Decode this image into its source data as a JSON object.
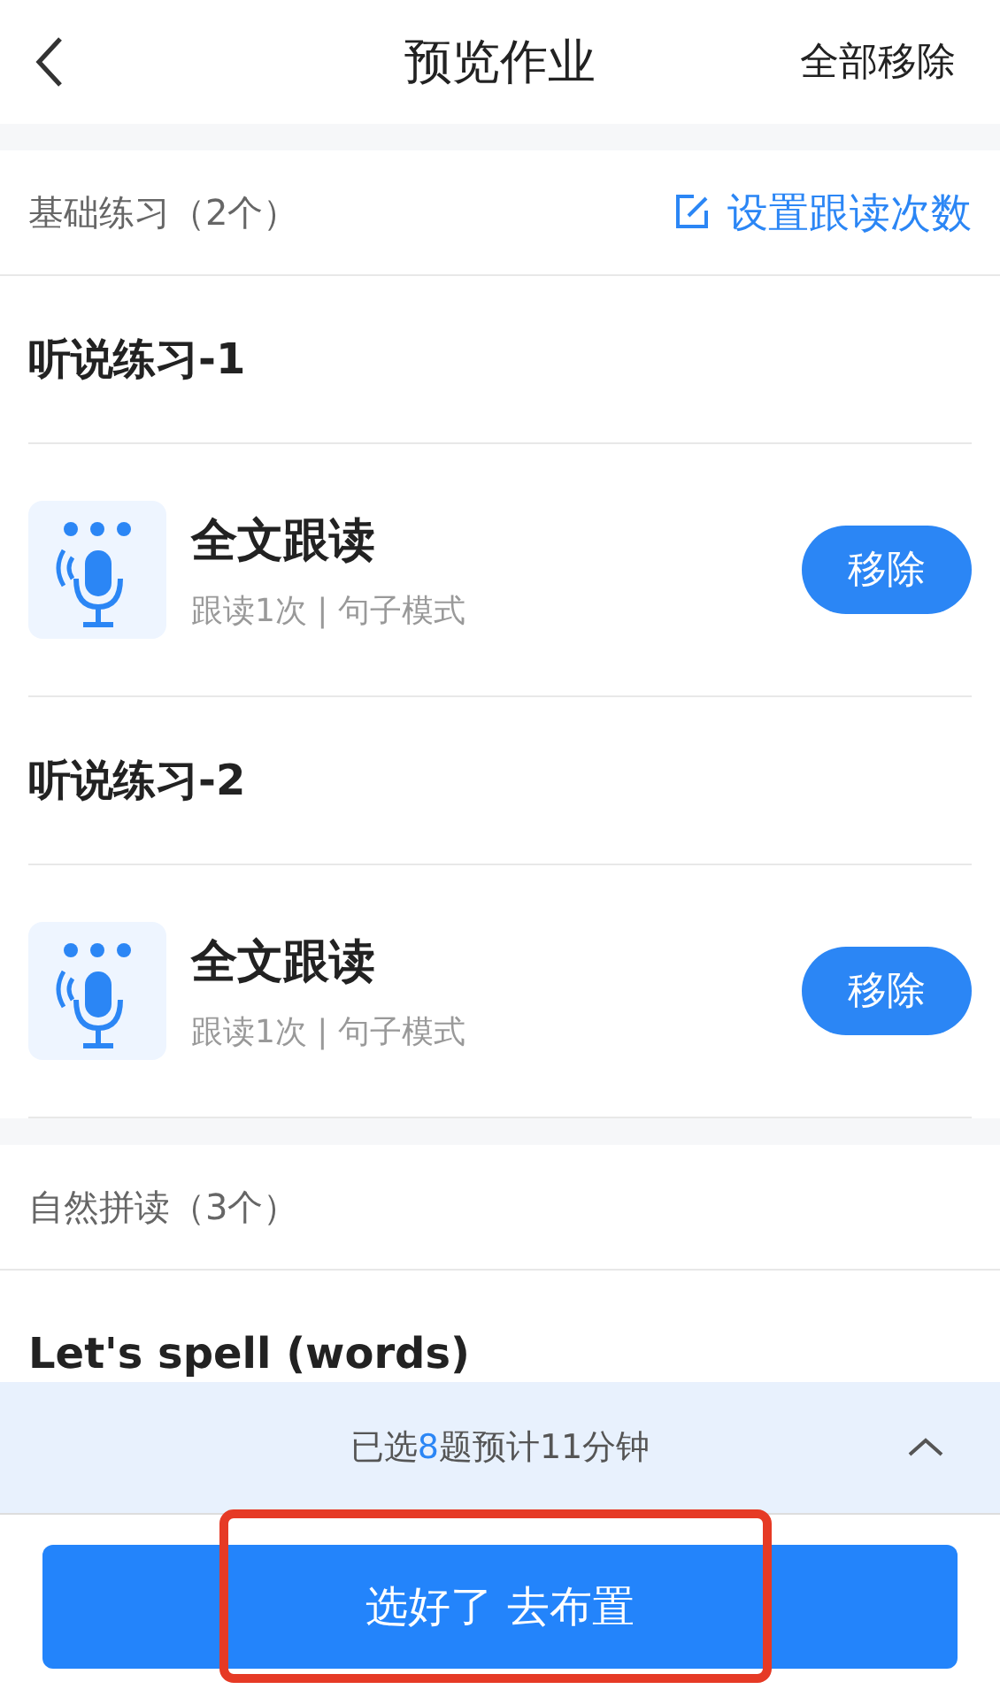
{
  "header": {
    "title": "预览作业",
    "action": "全部移除"
  },
  "sections": [
    {
      "title": "基础练习（2个）",
      "action": "设置跟读次数",
      "groups": [
        {
          "title": "听说练习-1",
          "items": [
            {
              "kind": "reading",
              "name": "全文跟读",
              "meta": "跟读1次 | 句子模式",
              "button": "移除"
            }
          ]
        },
        {
          "title": "听说练习-2",
          "items": [
            {
              "kind": "reading",
              "name": "全文跟读",
              "meta": "跟读1次 | 句子模式",
              "button": "移除"
            }
          ]
        }
      ]
    },
    {
      "title": "自然拼读（3个）",
      "groups": [
        {
          "title": "Let's spell (words)"
        }
      ]
    }
  ],
  "summary": {
    "before": "已选",
    "count": "8",
    "after": "题预计11分钟",
    "expanded": false
  },
  "submit": {
    "label": "选好了 去布置",
    "highlighted": true
  }
}
